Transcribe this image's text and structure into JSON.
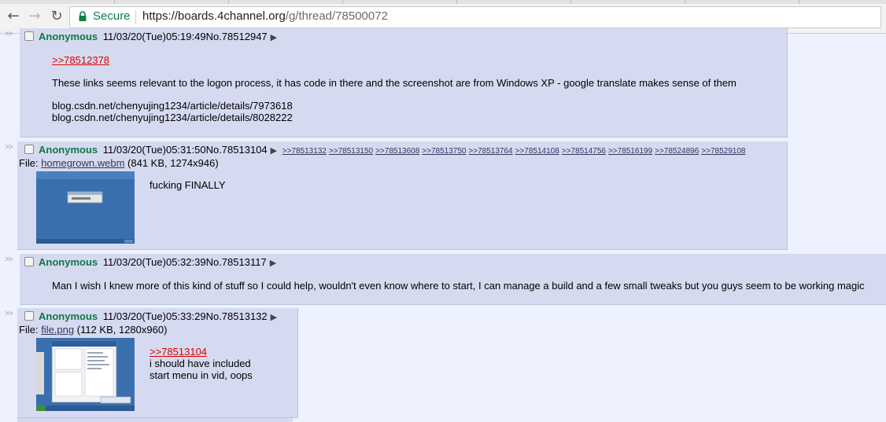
{
  "browser": {
    "secure_label": "Secure",
    "url_host": "https://boards.4channel.org",
    "url_path": "/g/thread/78500072"
  },
  "side_marker": ">>",
  "posts": [
    {
      "name": "Anonymous",
      "datetime": "11/03/20(Tue)05:19:49",
      "number": "No.78512947",
      "quote": ">>78512378",
      "lines": [
        "These links seems relevant to the logon process, it has code in there and the screenshot are from Windows XP - google translate makes sense of them",
        "blog.csdn.net/chenyujing1234/article/details/7973618",
        "blog.csdn.net/chenyujing1234/article/details/8028222"
      ]
    },
    {
      "name": "Anonymous",
      "datetime": "11/03/20(Tue)05:31:50",
      "number": "No.78513104",
      "backlinks": [
        ">>78513132",
        ">>78513150",
        ">>78513608",
        ">>78513750",
        ">>78513764",
        ">>78514108",
        ">>78514756",
        ">>78516199",
        ">>78524896",
        ">>78529108"
      ],
      "file_label": "File:",
      "file_name": "homegrown.webm",
      "file_meta": "(841 KB, 1274x946)",
      "text": "fucking FINALLY"
    },
    {
      "name": "Anonymous",
      "datetime": "11/03/20(Tue)05:32:39",
      "number": "No.78513117",
      "text": "Man I wish I knew more of this kind of stuff so I could help, wouldn't even know where to start, I can manage a build and a few small tweaks but you guys seem to be working magic"
    },
    {
      "name": "Anonymous",
      "datetime": "11/03/20(Tue)05:33:29",
      "number": "No.78513132",
      "file_label": "File:",
      "file_name": "file.png",
      "file_meta": "(112 KB, 1280x960)",
      "quote": ">>78513104",
      "lines": [
        "i should have included",
        "start menu in vid, oops"
      ]
    }
  ],
  "icons": {
    "back": "arrow-left-icon",
    "forward": "arrow-right-icon",
    "reload": "reload-icon",
    "lock": "lock-icon",
    "menu": "triangle-right-icon"
  }
}
